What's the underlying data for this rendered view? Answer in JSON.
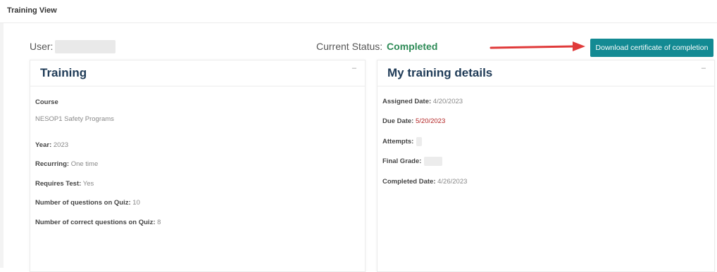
{
  "page": {
    "title": "Training View"
  },
  "header": {
    "user_label": "User:",
    "status_label": "Current Status:",
    "status_value": "Completed",
    "download_label": "Download certificate of completion"
  },
  "colors": {
    "accent_button": "#138a93",
    "status_completed": "#2e8b57",
    "due_date": "#b22222",
    "arrow": "#e03a3a",
    "card_title": "#1f3b57"
  },
  "training": {
    "title": "Training",
    "collapse_symbol": "–",
    "course_label": "Course",
    "course_value": "NESOP1 Safety Programs",
    "year_label": "Year:",
    "year_value": "2023",
    "recurring_label": "Recurring:",
    "recurring_value": "One time",
    "requires_test_label": "Requires Test:",
    "requires_test_value": "Yes",
    "questions_label": "Number of questions on Quiz:",
    "questions_value": "10",
    "correct_label": "Number of correct questions on Quiz:",
    "correct_value": "8"
  },
  "details": {
    "title": "My training details",
    "collapse_symbol": "–",
    "assigned_label": "Assigned Date:",
    "assigned_value": "4/20/2023",
    "due_label": "Due Date:",
    "due_value": "5/20/2023",
    "attempts_label": "Attempts:",
    "final_grade_label": "Final Grade:",
    "completed_label": "Completed Date:",
    "completed_value": "4/26/2023"
  }
}
